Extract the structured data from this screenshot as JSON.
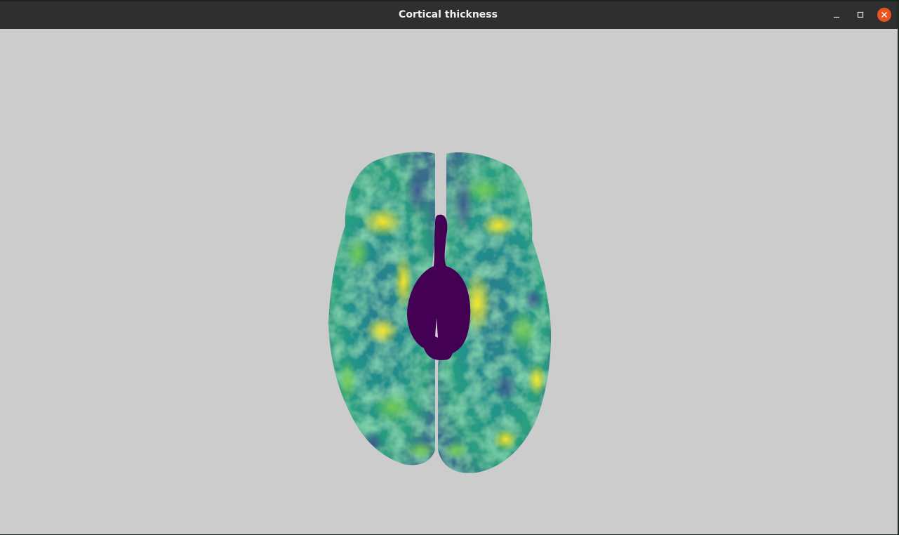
{
  "window": {
    "title": "Cortical thickness",
    "controls": {
      "minimize_icon": "minimize-icon",
      "maximize_icon": "maximize-icon",
      "close_icon": "close-icon"
    }
  },
  "viewport": {
    "background": "#cccccc",
    "scene": "brain-surface-render",
    "colormap": [
      "#440154",
      "#3b528b",
      "#21918c",
      "#5ec962",
      "#fde725"
    ]
  },
  "colors": {
    "titlebar": "#2f2f2f",
    "close_button": "#e95420"
  }
}
